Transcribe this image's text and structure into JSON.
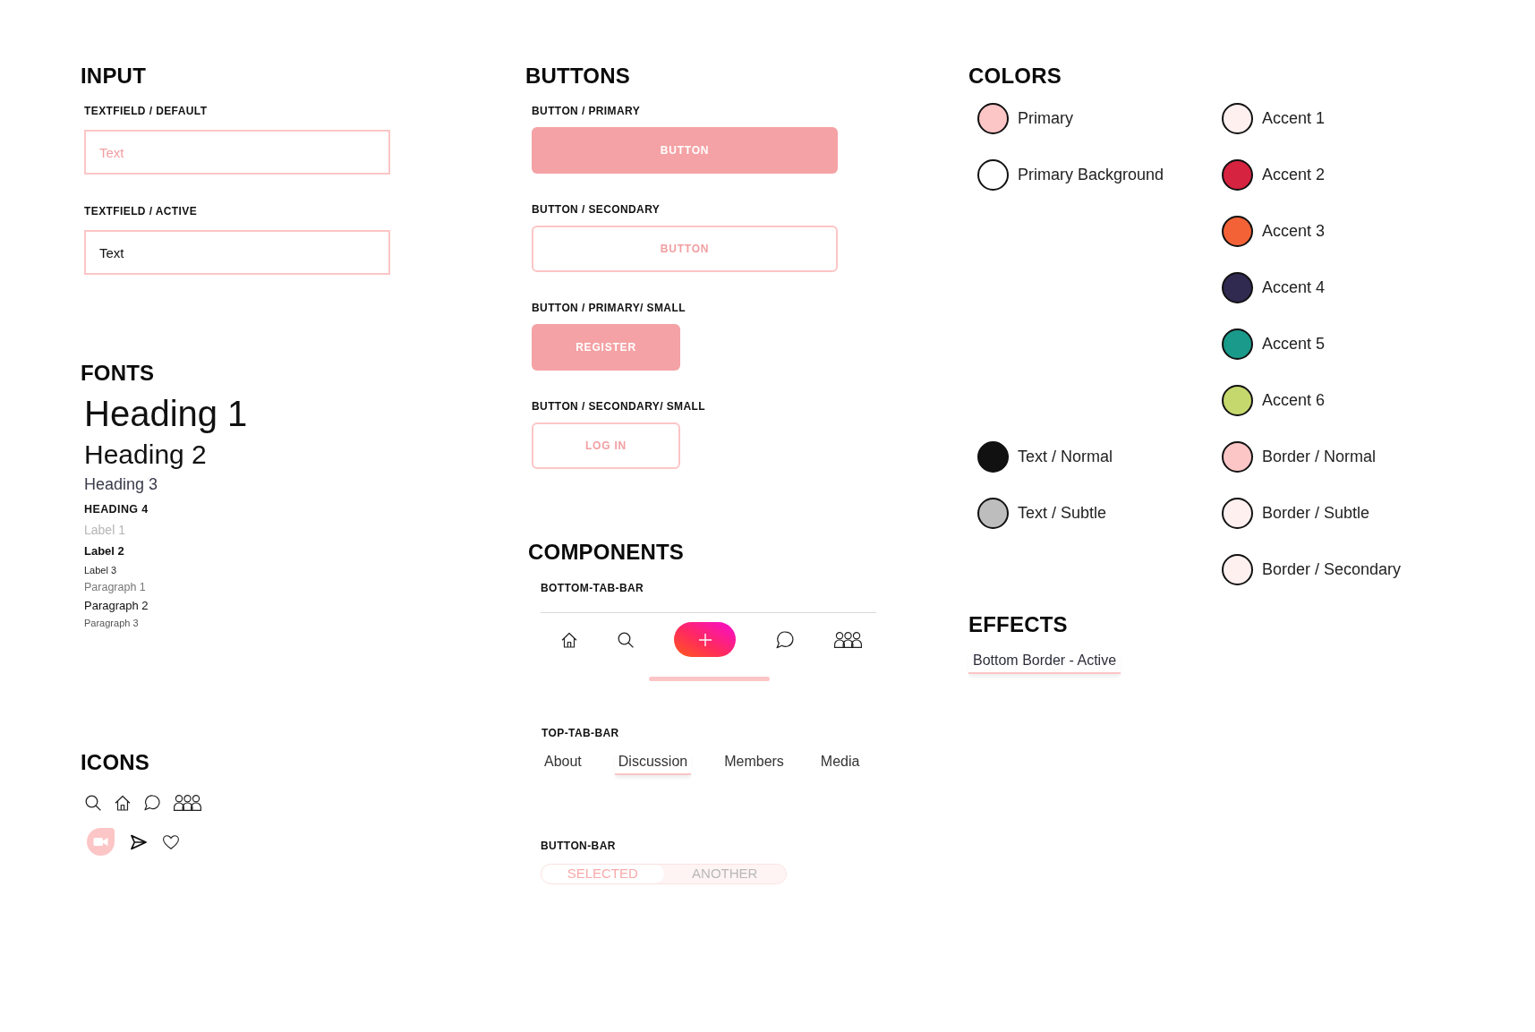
{
  "input": {
    "title": "INPUT",
    "fields": [
      {
        "caption": "TEXTFIELD / DEFAULT",
        "placeholder": "Text"
      },
      {
        "caption": "TEXTFIELD / ACTIVE",
        "value": "Text"
      }
    ]
  },
  "fonts": {
    "title": "FONTS",
    "samples": [
      {
        "kind": "h1",
        "text": "Heading 1"
      },
      {
        "kind": "h2",
        "text": "Heading 2"
      },
      {
        "kind": "h3",
        "text": "Heading 3"
      },
      {
        "kind": "h4",
        "text": "HEADING 4"
      },
      {
        "kind": "label1",
        "text": "Label 1"
      },
      {
        "kind": "label2",
        "text": "Label 2"
      },
      {
        "kind": "label3",
        "text": "Label 3"
      },
      {
        "kind": "p1",
        "text": "Paragraph 1"
      },
      {
        "kind": "p2",
        "text": "Paragraph 2"
      },
      {
        "kind": "p3",
        "text": "Paragraph 3"
      }
    ]
  },
  "icons": {
    "title": "ICONS"
  },
  "buttons": {
    "title": "BUTTONS",
    "items": [
      {
        "caption": "BUTTON / PRIMARY",
        "label": "BUTTON",
        "kind": "primary",
        "small": false
      },
      {
        "caption": "BUTTON / SECONDARY",
        "label": "BUTTON",
        "kind": "secondary",
        "small": false
      },
      {
        "caption": "BUTTON / PRIMARY/ SMALL",
        "label": "REGISTER",
        "kind": "primary",
        "small": true
      },
      {
        "caption": "BUTTON / SECONDARY/ SMALL",
        "label": "LOG IN",
        "kind": "secondary",
        "small": true
      }
    ]
  },
  "components": {
    "title": "COMPONENTS",
    "bottom_tab_bar": {
      "caption": "BOTTOM-TAB-BAR"
    },
    "top_tab_bar": {
      "caption": "TOP-TAB-BAR",
      "tabs": [
        {
          "label": "About",
          "selected": false
        },
        {
          "label": "Discussion",
          "selected": true
        },
        {
          "label": "Members",
          "selected": false
        },
        {
          "label": "Media",
          "selected": false
        }
      ]
    },
    "button_bar": {
      "caption": "BUTTON-BAR",
      "segments": [
        {
          "label": "SELECTED",
          "selected": true
        },
        {
          "label": "ANOTHER",
          "selected": false
        }
      ]
    }
  },
  "colors": {
    "title": "COLORS",
    "column_1": [
      [
        {
          "name": "Primary",
          "color": "#fcc5c6"
        },
        {
          "name": "Primary Background",
          "color": "#ffffff"
        }
      ],
      [
        {
          "name": "Text / Normal",
          "color": "#111111"
        },
        {
          "name": "Text / Subtle",
          "color": "#bdbdbd"
        }
      ]
    ],
    "column_2": [
      {
        "name": "Accent 1",
        "color": "#fff0f0"
      },
      {
        "name": "Accent 2",
        "color": "#d62340"
      },
      {
        "name": "Accent 3",
        "color": "#f26236"
      },
      {
        "name": "Accent 4",
        "color": "#302950"
      },
      {
        "name": "Accent 5",
        "color": "#1a9a8a"
      },
      {
        "name": "Accent 6",
        "color": "#c5d86d"
      },
      {
        "name": "Border / Normal",
        "color": "#fcc5c6"
      },
      {
        "name": "Border / Subtle",
        "color": "#fff0f0"
      },
      {
        "name": "Border / Secondary",
        "color": "#fff0f0"
      }
    ]
  },
  "effects": {
    "title": "EFFECTS",
    "samples": [
      "Bottom Border - Active"
    ]
  }
}
